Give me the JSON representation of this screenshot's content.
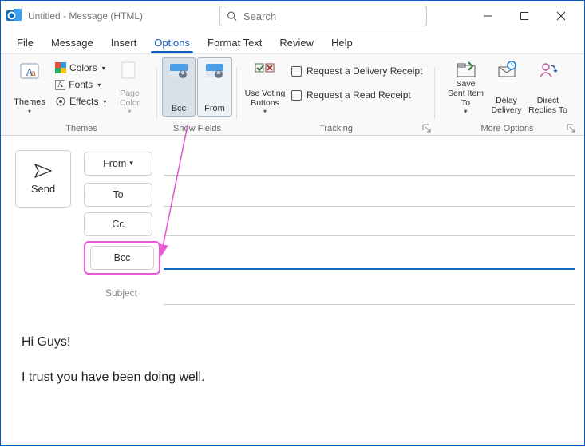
{
  "window": {
    "title": "Untitled  -  Message (HTML)"
  },
  "search": {
    "placeholder": "Search"
  },
  "tabs": {
    "file": "File",
    "message": "Message",
    "insert": "Insert",
    "options": "Options",
    "formattext": "Format Text",
    "review": "Review",
    "help": "Help"
  },
  "ribbon": {
    "themes": {
      "label": "Themes",
      "themesBtn": "Themes",
      "colors": "Colors",
      "fonts": "Fonts",
      "effects": "Effects",
      "pageColor": "Page Color"
    },
    "showfields": {
      "label": "Show Fields",
      "bcc": "Bcc",
      "from": "From"
    },
    "tracking": {
      "label": "Tracking",
      "voting": "Use Voting Buttons",
      "deliveryReceipt": "Request a Delivery Receipt",
      "readReceipt": "Request a Read Receipt"
    },
    "moreoptions": {
      "label": "More Options",
      "saveSent": "Save Sent Item To",
      "delay": "Delay Delivery",
      "direct": "Direct Replies To"
    }
  },
  "compose": {
    "send": "Send",
    "from": "From",
    "to": "To",
    "cc": "Cc",
    "bcc": "Bcc",
    "subjectPlaceholder": "Subject"
  },
  "body": {
    "line1": "Hi Guys!",
    "line2": "I trust you have been doing well."
  }
}
